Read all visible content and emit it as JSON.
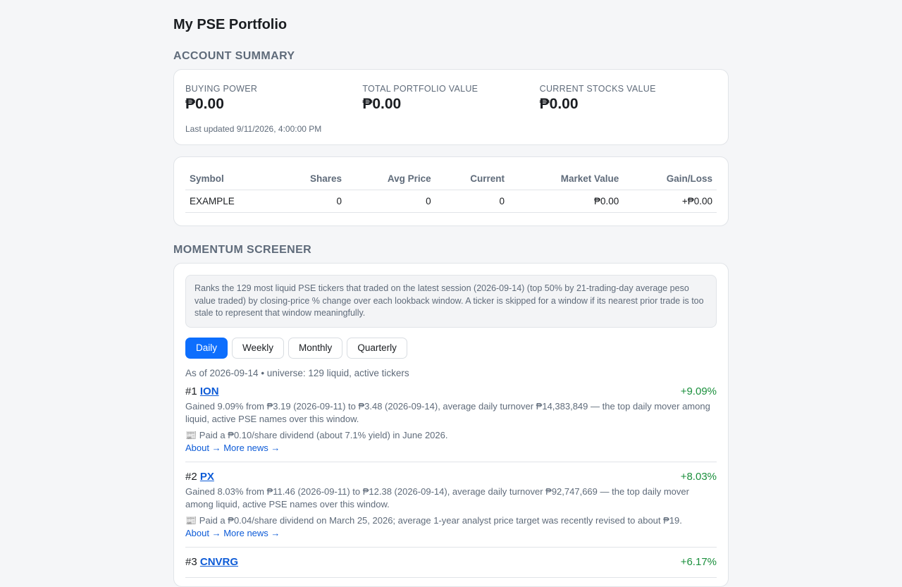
{
  "page": {
    "title": "My PSE Portfolio"
  },
  "account_summary": {
    "heading": "ACCOUNT SUMMARY",
    "stats": [
      {
        "label": "BUYING POWER",
        "value": "₱0.00"
      },
      {
        "label": "TOTAL PORTFOLIO VALUE",
        "value": "₱0.00"
      },
      {
        "label": "CURRENT STOCKS VALUE",
        "value": "₱0.00"
      }
    ],
    "last_updated": "Last updated 9/11/2026, 4:00:00 PM"
  },
  "holdings": {
    "columns": [
      "Symbol",
      "Shares",
      "Avg Price",
      "Current",
      "Market Value",
      "Gain/Loss"
    ],
    "rows": [
      [
        "EXAMPLE",
        "0",
        "0",
        "0",
        "₱0.00",
        "+₱0.00"
      ]
    ]
  },
  "screener": {
    "heading": "MOMENTUM SCREENER",
    "explanation": "Ranks the 129 most liquid PSE tickers that traded on the latest session (2026-09-14) (top 50% by 21-trading-day average peso value traded) by closing-price % change over each lookback window. A ticker is skipped for a window if its nearest prior trade is too stale to represent that window meaningfully.",
    "tabs": [
      {
        "label": "Daily",
        "active": true
      },
      {
        "label": "Weekly",
        "active": false
      },
      {
        "label": "Monthly",
        "active": false
      },
      {
        "label": "Quarterly",
        "active": false
      }
    ],
    "as_of": "As of 2026-09-14 • universe: 129 liquid, active tickers",
    "about_label": "About →",
    "more_news_label": "More news →",
    "movers": [
      {
        "rank": "#1",
        "symbol": "ION",
        "change": "+9.09%",
        "description": "Gained 9.09% from ₱3.19 (2026-09-11) to ₱3.48 (2026-09-14), average daily turnover ₱14,383,849 — the top daily mover among liquid, active PSE names over this window.",
        "news": "📰 Paid a ₱0.10/share dividend (about 7.1% yield) in June 2026."
      },
      {
        "rank": "#2",
        "symbol": "PX",
        "change": "+8.03%",
        "description": "Gained 8.03% from ₱11.46 (2026-09-11) to ₱12.38 (2026-09-14), average daily turnover ₱92,747,669 — the top daily mover among liquid, active PSE names over this window.",
        "news": "📰 Paid a ₱0.04/share dividend on March 25, 2026; average 1-year analyst price target was recently revised to about ₱19."
      },
      {
        "rank": "#3",
        "symbol": "CNVRG",
        "change": "+6.17%",
        "description": "",
        "news": ""
      }
    ]
  }
}
